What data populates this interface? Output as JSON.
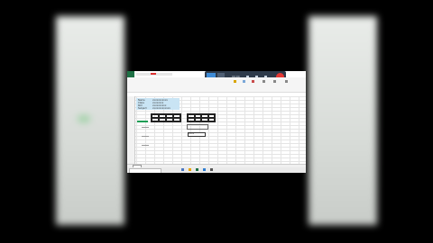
{
  "excel": {
    "labels": [
      "Name",
      "Class",
      "Roll",
      "Subject",
      "Date"
    ],
    "values": [
      "xxxxxxxxxxx",
      "xxxxxxxx",
      "xxxxxxxxxx",
      "xxxxxxxxxxxxx"
    ],
    "cell_value": "xxxx"
  },
  "recorder": {
    "time": "00:00"
  },
  "colors": {
    "excel_green": "#1e7145",
    "recorder_bg": "#2e3a4a",
    "record_red": "#e53935",
    "selection_blue": "#c9e4f4"
  },
  "taskbar": {
    "search_placeholder": "",
    "time": "",
    "date": ""
  }
}
